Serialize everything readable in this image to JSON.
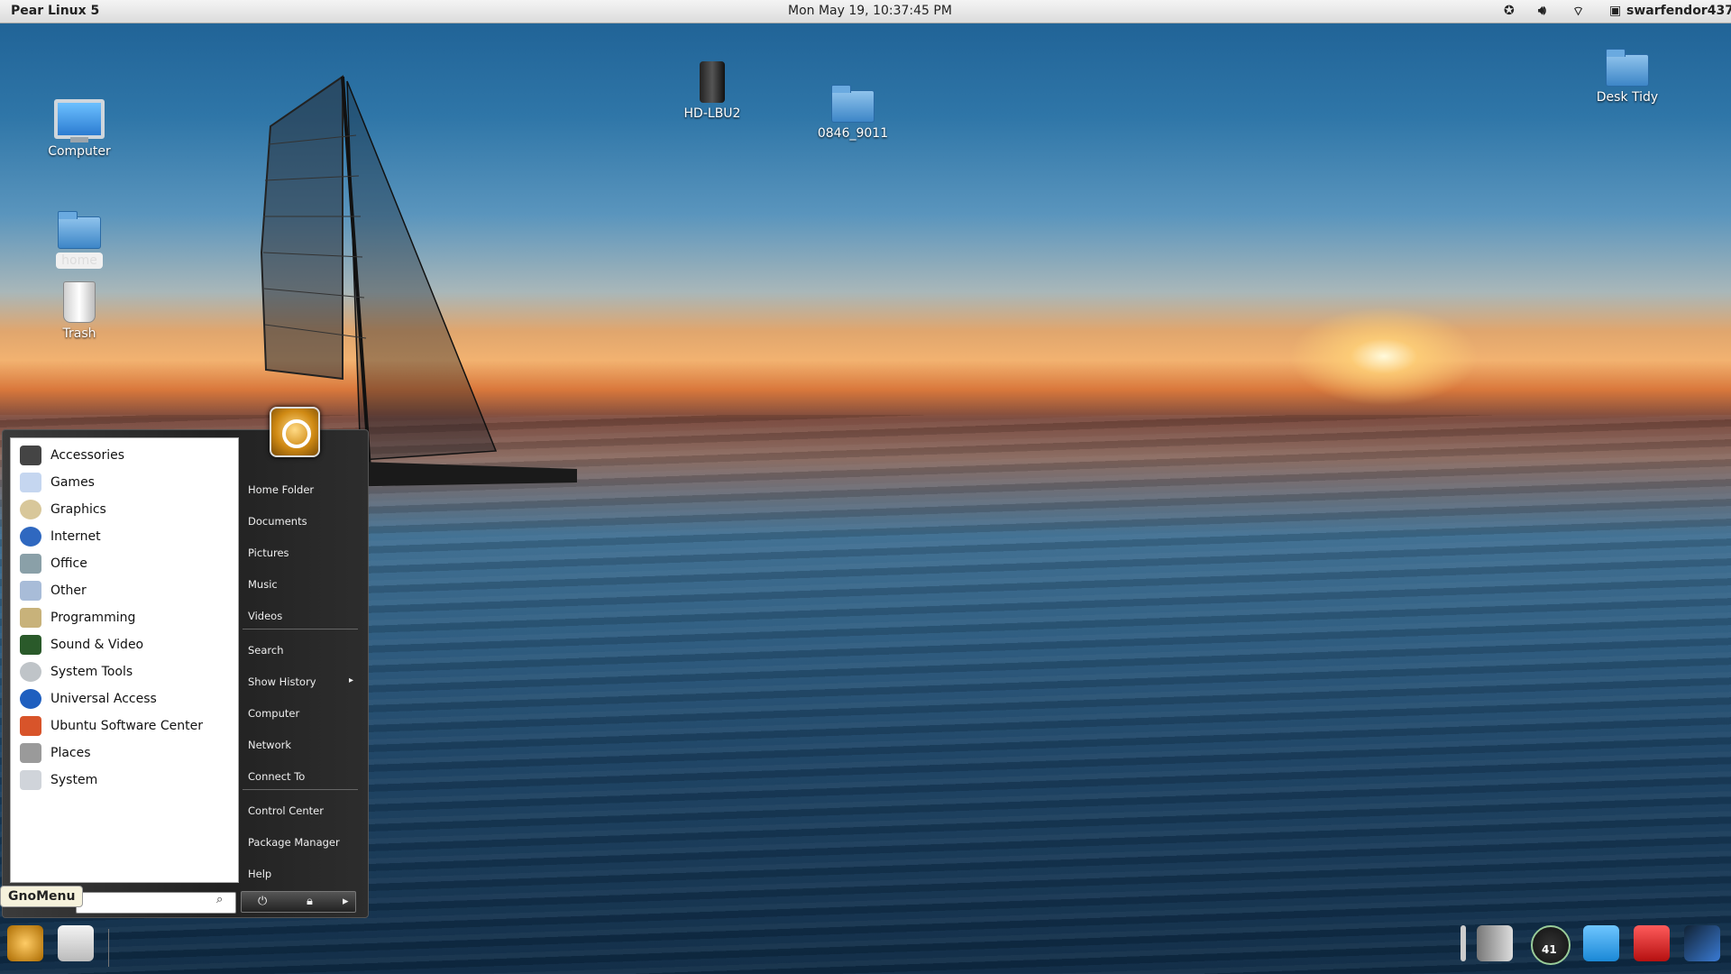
{
  "top_panel": {
    "distro": "Pear Linux 5",
    "clock": "Mon May 19, 10:37:45 PM",
    "user": "swarfendor437"
  },
  "desktop_icons": [
    {
      "label": "Computer",
      "icon": "computer-icon"
    },
    {
      "label": "home",
      "icon": "home-folder-icon"
    },
    {
      "label": "Trash",
      "icon": "trash-icon"
    },
    {
      "label": "HD-LBU2",
      "icon": "drive-icon"
    },
    {
      "label": "0846_9011",
      "icon": "folder-icon"
    },
    {
      "label": "Desk Tidy",
      "icon": "folder-icon"
    }
  ],
  "menu": {
    "label": "GnoMenu",
    "categories": [
      "Accessories",
      "Games",
      "Graphics",
      "Internet",
      "Office",
      "Other",
      "Programming",
      "Sound & Video",
      "System Tools",
      "Universal Access",
      "Ubuntu Software Center",
      "Places",
      "System"
    ],
    "places": [
      "Home Folder",
      "Documents",
      "Pictures",
      "Music",
      "Videos",
      "Search",
      "Show History",
      "Computer",
      "Network",
      "Connect To",
      "Control Center",
      "Package Manager",
      "Help"
    ],
    "search_placeholder": ""
  },
  "dock": {
    "meter_value": "41"
  },
  "colors": {
    "panel_bg": "#e6e6e6",
    "menu_bg": "#222222",
    "folder_blue": "#3d86c7"
  }
}
